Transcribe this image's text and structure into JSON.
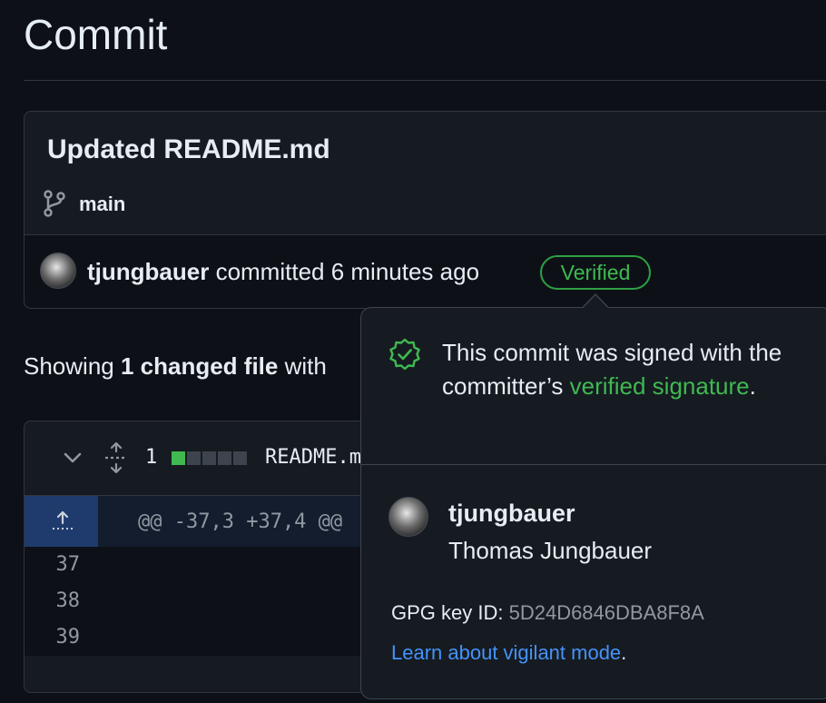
{
  "page": {
    "title": "Commit"
  },
  "commit": {
    "message": "Updated README.md",
    "branch": "main",
    "author": "tjungbauer",
    "action_text": " committed 6 minutes ago",
    "badge": "Verified"
  },
  "summary": {
    "prefix": "Showing ",
    "changed": "1 changed file",
    "suffix": " with"
  },
  "file": {
    "change_count": "1",
    "name": "README.m",
    "diffstat": [
      "added",
      "neutral",
      "neutral",
      "neutral",
      "neutral"
    ],
    "hunk_header": "@@ -37,3 +37,4 @@",
    "line_numbers": [
      "37",
      "38",
      "39"
    ]
  },
  "popover": {
    "signed_text_1": "This commit was signed with the committer’s ",
    "signed_link": "verified signature",
    "signed_text_2": ".",
    "login": "tjungbauer",
    "full_name": "Thomas Jungbauer",
    "gpg_label": "GPG key ID: ",
    "gpg_key": "5D24D6846DBA8F8A",
    "learn_link": "Learn about vigilant mode",
    "learn_suffix": "."
  },
  "colors": {
    "background": "#0d1117",
    "verified_green": "#3fb950",
    "link_blue": "#4493f8",
    "hunk_gutter": "#1f3b6e"
  },
  "icons": [
    "git-branch-icon",
    "chevron-down-icon",
    "unfold-icon",
    "expand-up-icon",
    "verified-shield-icon"
  ]
}
